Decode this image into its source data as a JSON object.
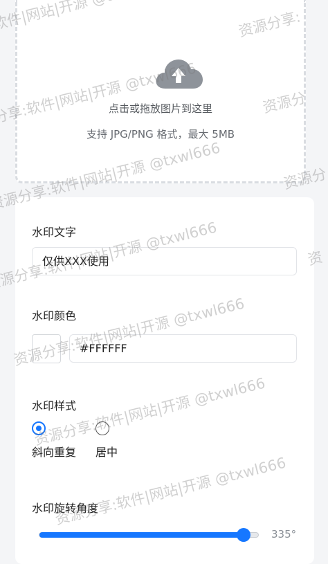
{
  "upload": {
    "icon": "cloud-upload-icon",
    "main_text": "点击或拖放图片到这里",
    "hint_text": "支持 JPG/PNG 格式，最大 5MB"
  },
  "watermark_text": {
    "label": "水印文字",
    "value": "仅供XXX使用"
  },
  "watermark_color": {
    "label": "水印颜色",
    "swatch_color": "#FFFFFF",
    "value": "#FFFFFF"
  },
  "watermark_style": {
    "label": "水印样式",
    "options": [
      {
        "label": "斜向重复",
        "checked": true
      },
      {
        "label": "居中",
        "checked": false
      }
    ]
  },
  "rotation": {
    "label": "水印旋转角度",
    "value_text": "335°",
    "fraction": 0.93
  },
  "overlay_watermark": {
    "text_a": "资源分享:软件|网站|开源 @txwl666",
    "text_b": "软件|网站|开源 @txwl666",
    "text_c": "资源分享:",
    "text_d": "资源分",
    "text_e": "资",
    "color": "#787878"
  },
  "accent_color": "#1677ff"
}
